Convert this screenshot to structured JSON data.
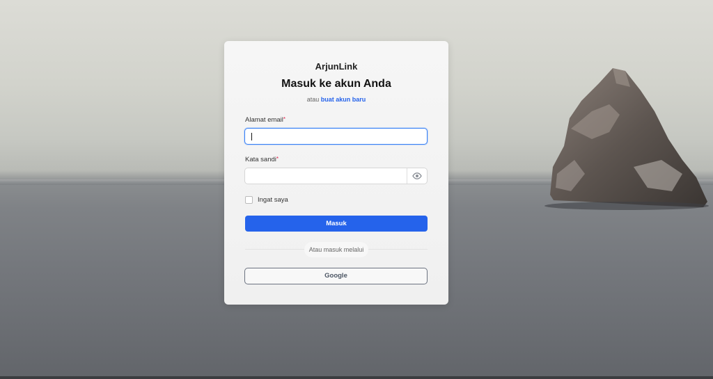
{
  "brand": "ArjunLink",
  "heading": "Masuk ke akun Anda",
  "subline": {
    "prefix": "atau",
    "link": "buat akun baru"
  },
  "email": {
    "label": "Alamat email",
    "required_mark": "*",
    "value": ""
  },
  "password": {
    "label": "Kata sandi",
    "required_mark": "*",
    "value": "",
    "toggle_icon": "eye-icon"
  },
  "remember": {
    "label": "Ingat saya",
    "checked": false
  },
  "submit_label": "Masuk",
  "divider_text": "Atau masuk melalui",
  "google_label": "Google",
  "colors": {
    "primary": "#2563eb",
    "focus_border": "#3b82f6",
    "required": "#e11d48"
  }
}
